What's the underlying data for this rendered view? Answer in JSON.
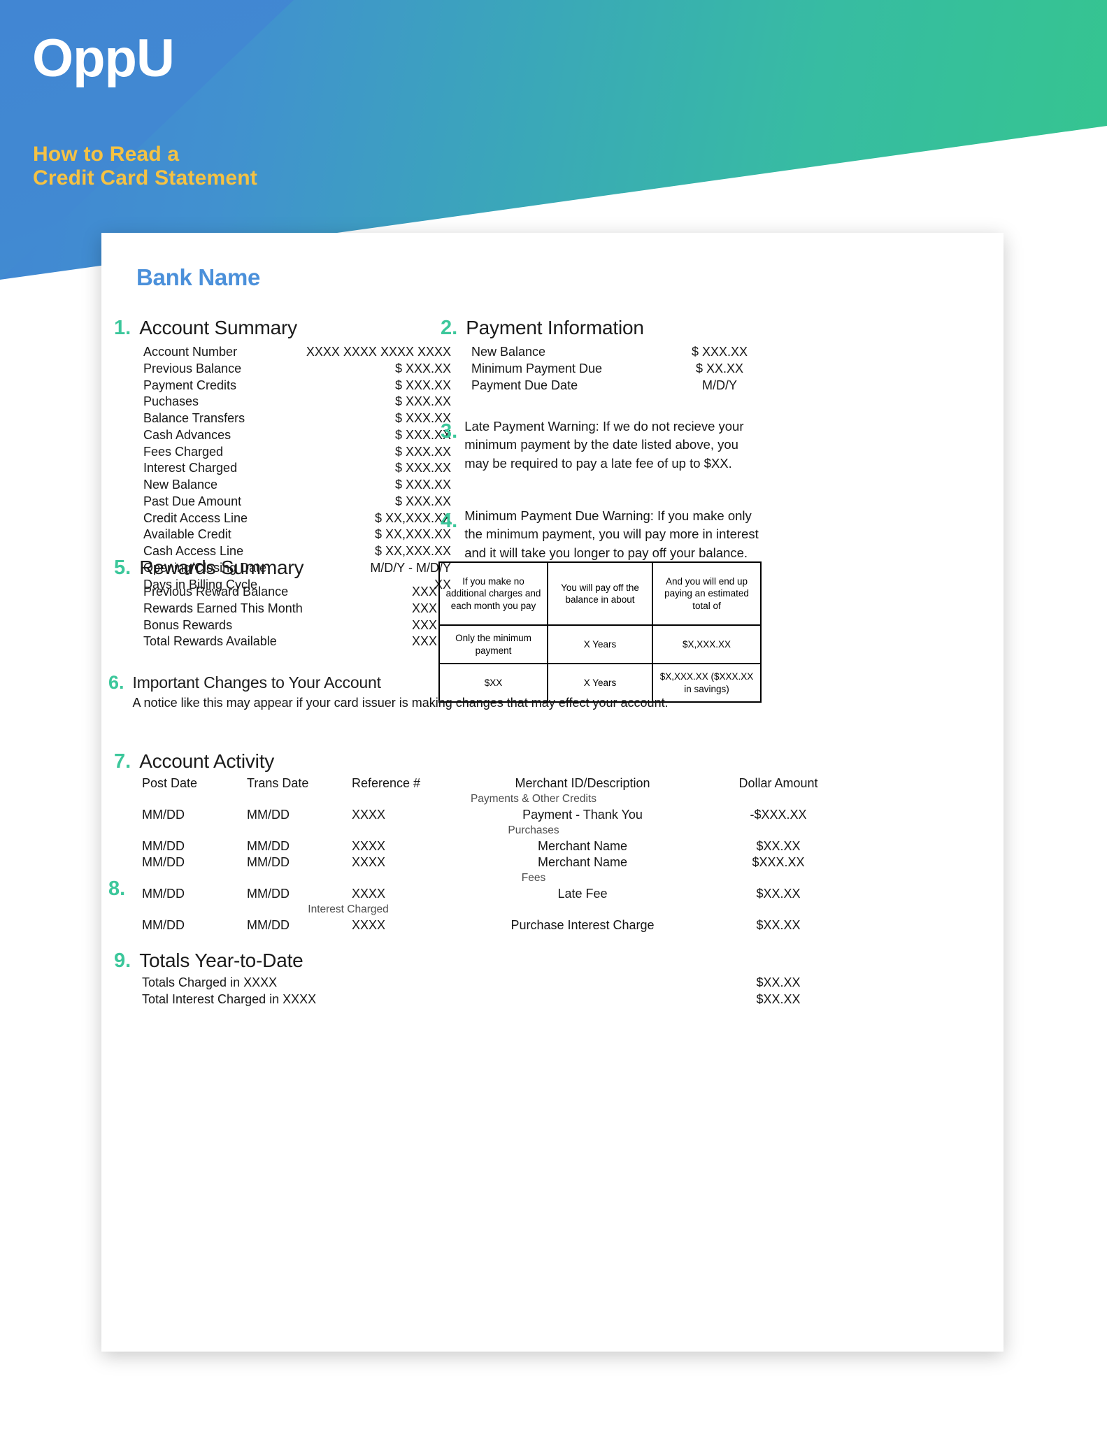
{
  "brand": {
    "logo": "OppU",
    "subtitle_line1": "How to Read a",
    "subtitle_line2": "Credit Card Statement",
    "accent_blue": "#4186d3",
    "accent_green": "#35c58f",
    "accent_yellow": "#f5c243",
    "number_color": "#3cc79b",
    "bank_name_color": "#4b90da"
  },
  "statement": {
    "bank_name": "Bank Name",
    "sections": {
      "account_summary": {
        "number": "1.",
        "title": "Account Summary",
        "rows": [
          {
            "label": "Account Number",
            "value": "XXXX XXXX XXXX XXXX"
          },
          {
            "label": "Previous Balance",
            "value": "$ XXX.XX"
          },
          {
            "label": "Payment Credits",
            "value": "$ XXX.XX"
          },
          {
            "label": "Puchases",
            "value": "$ XXX.XX"
          },
          {
            "label": "Balance Transfers",
            "value": "$ XXX.XX"
          },
          {
            "label": "Cash Advances",
            "value": "$ XXX.XX"
          },
          {
            "label": "Fees Charged",
            "value": "$ XXX.XX"
          },
          {
            "label": "Interest Charged",
            "value": "$ XXX.XX"
          },
          {
            "label": "New Balance",
            "value": "$ XXX.XX"
          },
          {
            "label": "Past Due Amount",
            "value": "$ XXX.XX"
          },
          {
            "label": "Credit Access Line",
            "value": "$ XX,XXX.XX"
          },
          {
            "label": "Available Credit",
            "value": "$ XX,XXX.XX"
          },
          {
            "label": "Cash Access Line",
            "value": "$ XX,XXX.XX"
          },
          {
            "label": "Opening/Closing Date",
            "value": "M/D/Y - M/D/Y"
          },
          {
            "label": "Days in Billing Cycle",
            "value": "XX"
          }
        ]
      },
      "payment_information": {
        "number": "2.",
        "title": "Payment Information",
        "rows": [
          {
            "label": "New Balance",
            "value": "$ XXX.XX"
          },
          {
            "label": "Minimum Payment Due",
            "value": "$ XX.XX"
          },
          {
            "label": "Payment Due Date",
            "value": "M/D/Y"
          }
        ]
      },
      "late_payment_warning": {
        "number": "3.",
        "text": "Late Payment Warning: If we do not recieve your minimum payment by the date listed above, you may be required to pay a late fee of up to $XX."
      },
      "minimum_payment_warning": {
        "number": "4.",
        "text": "Minimum Payment Due Warning: If you make only the minimum payment, you will pay more in interest and it will take you longer to pay off your balance."
      },
      "rewards_summary": {
        "number": "5.",
        "title": "Rewards Summary",
        "rows": [
          {
            "label": "Previous  Reward Balance",
            "value": "XXX"
          },
          {
            "label": "Rewards Earned This Month",
            "value": "XXX"
          },
          {
            "label": "Bonus Rewards",
            "value": "XXX"
          },
          {
            "label": "Total Rewards Available",
            "value": "XXX"
          }
        ]
      },
      "important_changes": {
        "number": "6.",
        "title": "Important Changes to Your Account",
        "note": "A notice like this may appear if your card issuer is making changes that may effect your account."
      },
      "account_activity": {
        "number": "7.",
        "marker_number": "8.",
        "title": "Account Activity",
        "columns": [
          "Post Date",
          "Trans Date",
          "Reference #",
          "Merchant ID/Description",
          "Dollar Amount"
        ],
        "groups": [
          {
            "group_label": "Payments & Other Credits",
            "rows": [
              {
                "post_date": "MM/DD",
                "trans_date": "MM/DD",
                "reference": "XXXX",
                "description": "Payment - Thank You",
                "amount": "-$XXX.XX"
              }
            ]
          },
          {
            "group_label": "Purchases",
            "rows": [
              {
                "post_date": "MM/DD",
                "trans_date": "MM/DD",
                "reference": "XXXX",
                "description": "Merchant Name",
                "amount": "$XX.XX"
              },
              {
                "post_date": "MM/DD",
                "trans_date": "MM/DD",
                "reference": "XXXX",
                "description": "Merchant Name",
                "amount": "$XXX.XX"
              }
            ]
          },
          {
            "group_label": "Fees",
            "rows": [
              {
                "post_date": "MM/DD",
                "trans_date": "MM/DD",
                "reference": "XXXX",
                "description": "Late Fee",
                "amount": "$XX.XX"
              }
            ]
          },
          {
            "group_label": "Interest Charged",
            "rows": [
              {
                "post_date": "MM/DD",
                "trans_date": "MM/DD",
                "reference": "XXXX",
                "description": "Purchase Interest Charge",
                "amount": "$XX.XX"
              }
            ]
          }
        ]
      },
      "totals_ytd": {
        "number": "9.",
        "title": "Totals Year-to-Date",
        "rows": [
          {
            "label": "Totals Charged in XXXX",
            "value": "$XX.XX"
          },
          {
            "label": "Total Interest Charged in XXXX",
            "value": "$XX.XX"
          }
        ]
      }
    },
    "payment_table": {
      "headers": [
        "If you make no additional charges and each month you pay",
        "You will pay off the balance in about",
        "And you will end up paying an estimated total of"
      ],
      "rows": [
        {
          "c1": "Only the minimum payment",
          "c2": "X Years",
          "c3": "$X,XXX.XX"
        },
        {
          "c1": "$XX",
          "c2": "X Years",
          "c3": "$X,XXX.XX ($XXX.XX in savings)"
        }
      ]
    }
  }
}
